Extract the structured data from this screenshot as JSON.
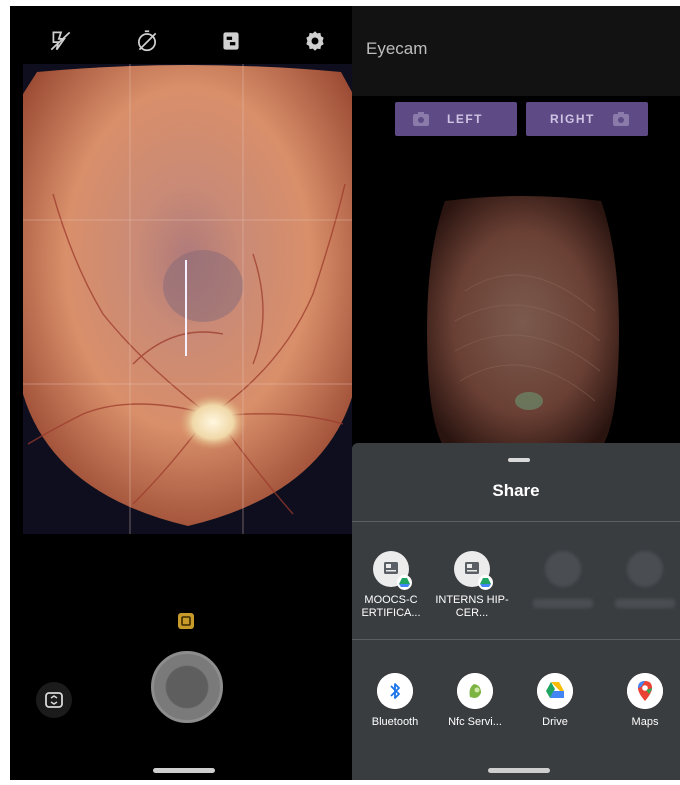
{
  "app": {
    "title": "Eyecam",
    "left_button": "LEFT",
    "right_button": "RIGHT"
  },
  "camera": {
    "toolbar_icons": [
      "flash-off-icon",
      "timer-off-icon",
      "aspect-ratio-icon",
      "settings-icon"
    ],
    "flash_mode_icon": "flash-auto-icon",
    "switch_icon": "switch-camera-icon"
  },
  "share": {
    "title": "Share",
    "direct_targets": [
      {
        "label": "MOOCS-C ERTIFICA...",
        "icon": "document-icon",
        "badge": "drive-icon"
      },
      {
        "label": "INTERNS HIP-CER...",
        "icon": "document-icon",
        "badge": "drive-icon"
      },
      {
        "label": "",
        "icon": "placeholder"
      },
      {
        "label": "",
        "icon": "placeholder"
      }
    ],
    "apps": [
      {
        "label": "Bluetooth",
        "icon": "bluetooth-icon"
      },
      {
        "label": "Nfc Servi...",
        "icon": "nfc-service-icon"
      },
      {
        "label": "Drive",
        "icon": "google-drive-icon"
      },
      {
        "label": "Maps",
        "icon": "google-maps-icon"
      }
    ]
  },
  "colors": {
    "button_purple": "#5e4b86",
    "sheet_background": "#3a3d40",
    "flash_badge": "#c79a2a"
  }
}
